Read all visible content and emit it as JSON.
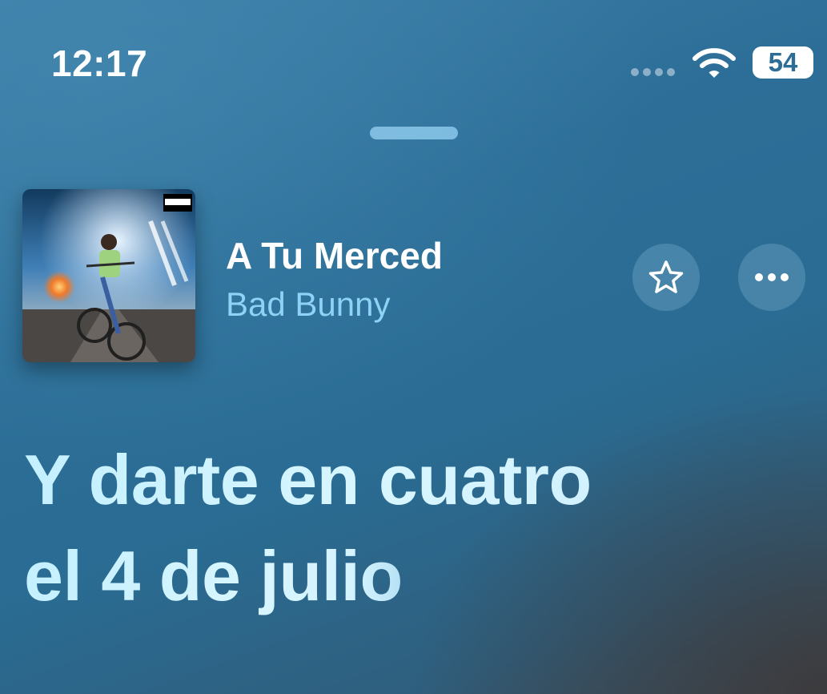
{
  "status_bar": {
    "time": "12:17",
    "battery_level": "54",
    "icons": [
      "cellular-signal-icon",
      "wifi-icon",
      "battery-icon"
    ]
  },
  "now_playing": {
    "title": "A Tu Merced",
    "artist": "Bad Bunny",
    "album_art_icon": "album-cover",
    "album_art_label": "PARENTAL ADVISORY EXPLICIT CONTENT",
    "favorite_icon": "star-icon",
    "more_icon": "ellipsis-icon"
  },
  "lyrics": {
    "current_line_1": "Y darte en cuatro",
    "current_line_2_main": "el 4 de juli",
    "current_line_2_fade": "o"
  },
  "colors": {
    "background": "#2c6e97",
    "artist_text": "#8ed3f5",
    "lyric_text": "#c4f0ff"
  }
}
